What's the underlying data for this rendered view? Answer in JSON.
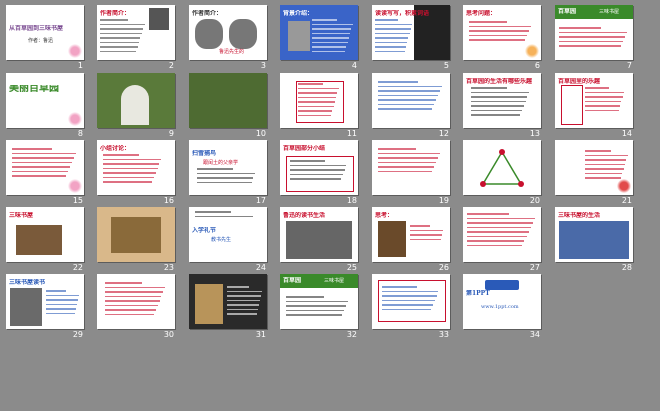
{
  "view": "slide sorter",
  "slides": [
    {
      "n": "1",
      "title": "从百草园到三味书屋",
      "sub": "作者：鲁迅"
    },
    {
      "n": "2",
      "title": "作者简介："
    },
    {
      "n": "3",
      "title": "作者简介：",
      "sub": "鲁迅先生的"
    },
    {
      "n": "4",
      "title": "背景介绍："
    },
    {
      "n": "5",
      "title": "读读写写，积累词语"
    },
    {
      "n": "6",
      "title": "思考问题："
    },
    {
      "n": "7",
      "title": "百草园",
      "sub": "三味书屋"
    },
    {
      "n": "8",
      "title": "美丽百草园"
    },
    {
      "n": "9"
    },
    {
      "n": "10"
    },
    {
      "n": "11"
    },
    {
      "n": "12"
    },
    {
      "n": "13",
      "title": "百草园的生活有哪些乐趣"
    },
    {
      "n": "14",
      "title": "百草园里的乐趣"
    },
    {
      "n": "15"
    },
    {
      "n": "16",
      "title": "小组讨论："
    },
    {
      "n": "17",
      "title": "扫雪捕鸟",
      "sub": "跟闰土的父亲学"
    },
    {
      "n": "18",
      "title": "百草园部分小结"
    },
    {
      "n": "19"
    },
    {
      "n": "20"
    },
    {
      "n": "21"
    },
    {
      "n": "22",
      "title": "三味书屋"
    },
    {
      "n": "23"
    },
    {
      "n": "24",
      "title": "入学礼节",
      "sub": "教书先生"
    },
    {
      "n": "25",
      "title": "鲁迅的读书生活"
    },
    {
      "n": "26",
      "title": "思考："
    },
    {
      "n": "27"
    },
    {
      "n": "28",
      "title": "三味书屋的生活"
    },
    {
      "n": "29",
      "title": "三味书屋读书"
    },
    {
      "n": "30"
    },
    {
      "n": "31"
    },
    {
      "n": "32",
      "title": "百草园",
      "sub": "三味书屋"
    },
    {
      "n": "33"
    },
    {
      "n": "34",
      "title": "第1PPT",
      "sub": "www.1ppt.com"
    }
  ],
  "colors": {
    "bg": "#8b8b8b",
    "purple": "#7a4b91",
    "red": "#c8102e",
    "green": "#3a8a2a",
    "blue": "#2a5ab8"
  }
}
